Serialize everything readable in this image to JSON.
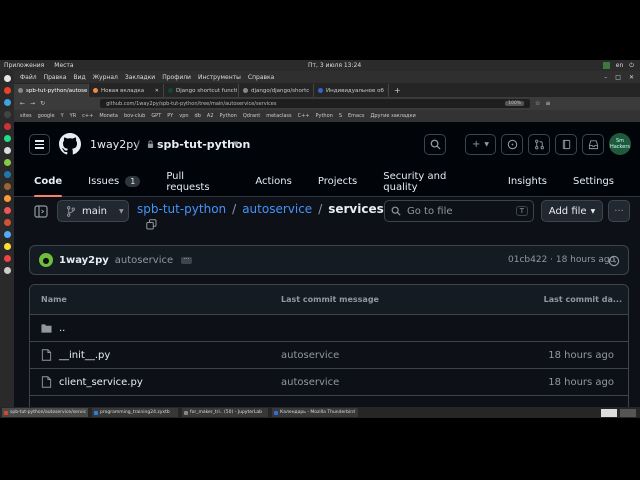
{
  "system": {
    "menu": [
      "Приложения",
      "Места"
    ],
    "clock": "Пт, 3 июля  13:24",
    "lang": "en"
  },
  "browser": {
    "menu": [
      "Файл",
      "Правка",
      "Вид",
      "Журнал",
      "Закладки",
      "Профили",
      "Инструменты",
      "Справка"
    ],
    "tabs": [
      {
        "label": "spb-tut-python/autose",
        "active": true
      },
      {
        "label": "Новая вкладка",
        "active": false
      },
      {
        "label": "Django shortcut functi",
        "active": false
      },
      {
        "label": "django/django/shortc",
        "active": false
      },
      {
        "label": "Индивидуальное об",
        "active": false
      }
    ],
    "url": "github.com/1way2py/spb-tut-python/tree/main/autoservice/services",
    "zoom": "100%",
    "bookmarks": [
      "sites",
      "google",
      "Y",
      "YR",
      "c++",
      "Moneta",
      "bov-club",
      "GPT",
      "PY",
      "vpn",
      "db",
      "A2",
      "Python",
      "Qdrant",
      "metaclass",
      "C++",
      "Python",
      "S",
      "Emacs",
      "Другие закладки"
    ]
  },
  "github": {
    "owner": "1way2py",
    "repo": "spb-tut-python",
    "avatar_text": "Sm Hackers",
    "nav": [
      {
        "label": "Code",
        "active": true
      },
      {
        "label": "Issues",
        "count": "1"
      },
      {
        "label": "Pull requests"
      },
      {
        "label": "Actions"
      },
      {
        "label": "Projects"
      },
      {
        "label": "Security and quality"
      },
      {
        "label": "Insights"
      },
      {
        "label": "Settings"
      }
    ],
    "branch": "main",
    "breadcrumb": {
      "repo": "spb-tut-python",
      "dir": "autoservice",
      "current": "services",
      "sep": "/"
    },
    "goto_file": {
      "placeholder": "Go to file",
      "shortcut": "T"
    },
    "add_file": "Add file",
    "commit": {
      "author": "1way2py",
      "message": "autoservice",
      "hash_time": "01cb422 · 18 hours ago"
    },
    "table": {
      "headers": {
        "name": "Name",
        "message": "Last commit message",
        "date": "Last commit da..."
      },
      "rows": [
        {
          "name": "..",
          "message": "",
          "date": "",
          "type": "folder"
        },
        {
          "name": "__init__.py",
          "message": "autoservice",
          "date": "18 hours ago",
          "type": "file"
        },
        {
          "name": "client_service.py",
          "message": "autoservice",
          "date": "18 hours ago",
          "type": "file"
        }
      ]
    }
  },
  "taskbar": {
    "tasks": [
      {
        "label": "spb-tut-python/autoservice/servic",
        "color": "#e0452c",
        "active": true
      },
      {
        "label": "programming_training24.zyxtb",
        "color": "#2f7de1",
        "active": false
      },
      {
        "label": "for_maker_tri.. (50) - JupyterLab",
        "color": "#888888",
        "active": false
      },
      {
        "label": "Календарь - Mozilla Thunderbird",
        "color": "#2f6ee0",
        "active": false
      }
    ]
  },
  "colors": {
    "accent": "#4493f8",
    "underline": "#f78166",
    "bg": "#0d1117"
  }
}
